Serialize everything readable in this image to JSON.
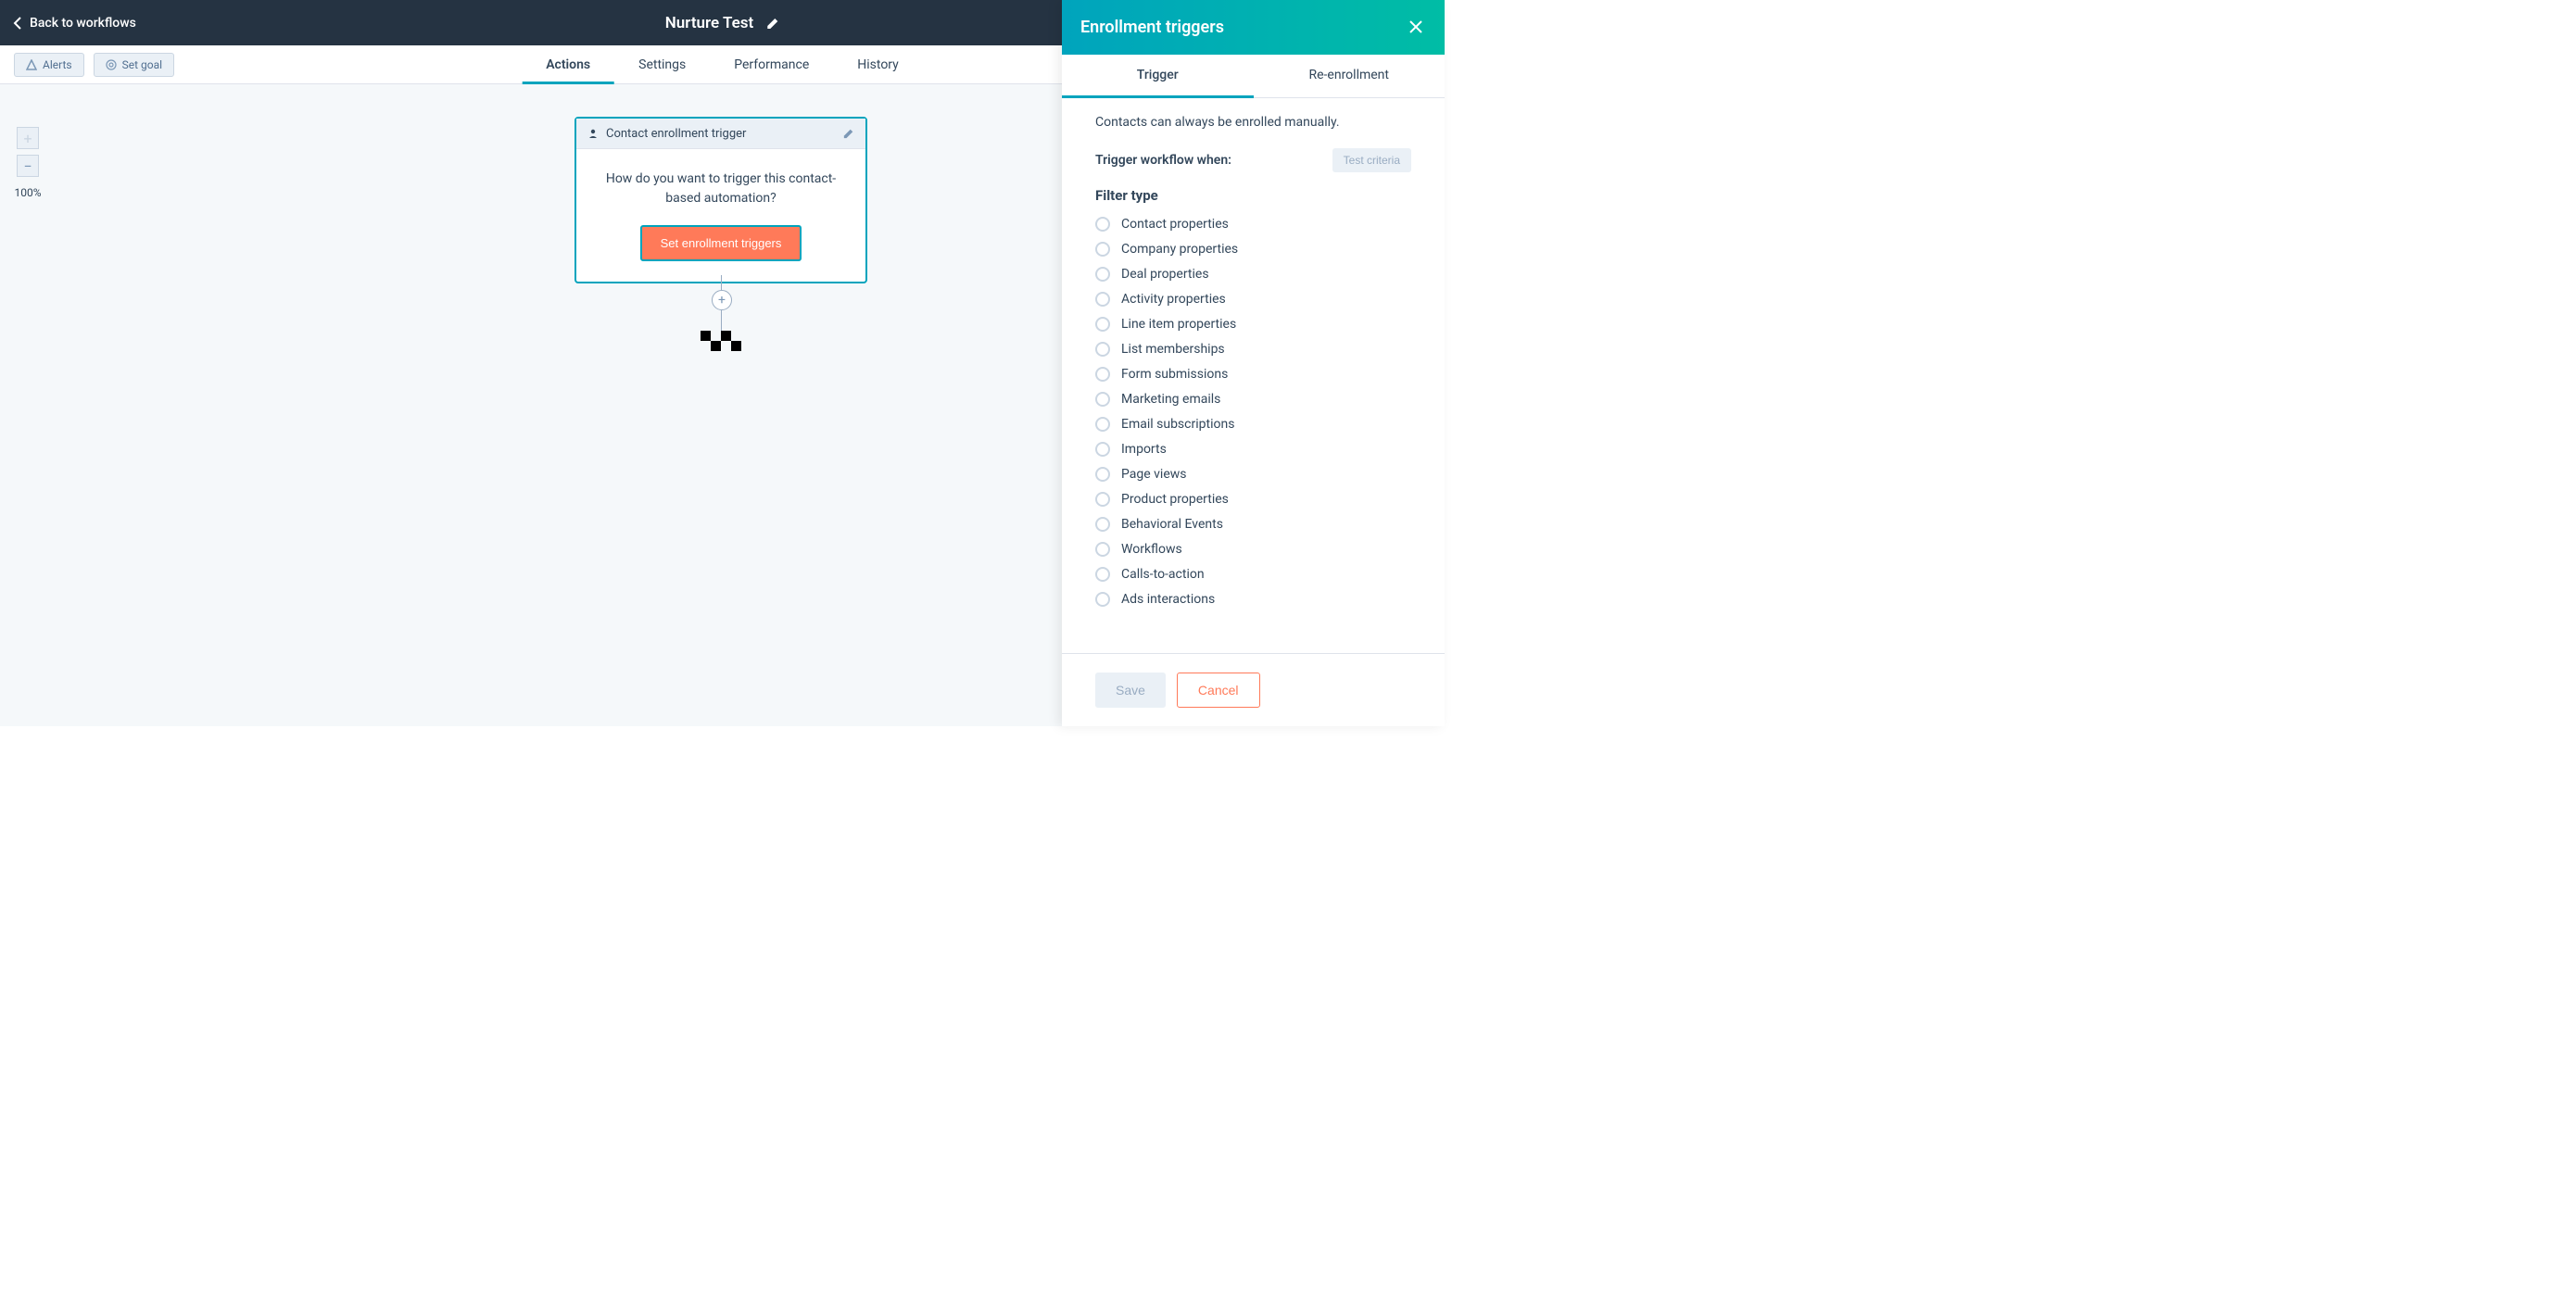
{
  "header": {
    "back_label": "Back to workflows",
    "title": "Nurture Test"
  },
  "toolbar": {
    "alerts_label": "Alerts",
    "set_goal_label": "Set goal"
  },
  "tabs": {
    "actions": "Actions",
    "settings": "Settings",
    "performance": "Performance",
    "history": "History"
  },
  "canvas": {
    "zoom_level": "100%",
    "trigger_card_title": "Contact enrollment trigger",
    "trigger_card_question": "How do you want to trigger this contact-based automation?",
    "trigger_card_cta": "Set enrollment triggers"
  },
  "panel": {
    "title": "Enrollment triggers",
    "tab_trigger": "Trigger",
    "tab_reenrollment": "Re-enrollment",
    "info_text": "Contacts can always be enrolled manually.",
    "subheader": "Trigger workflow when:",
    "test_btn": "Test criteria",
    "filter_heading": "Filter type",
    "filters": [
      "Contact properties",
      "Company properties",
      "Deal properties",
      "Activity properties",
      "Line item properties",
      "List memberships",
      "Form submissions",
      "Marketing emails",
      "Email subscriptions",
      "Imports",
      "Page views",
      "Product properties",
      "Behavioral Events",
      "Workflows",
      "Calls-to-action",
      "Ads interactions"
    ],
    "save_label": "Save",
    "cancel_label": "Cancel"
  }
}
